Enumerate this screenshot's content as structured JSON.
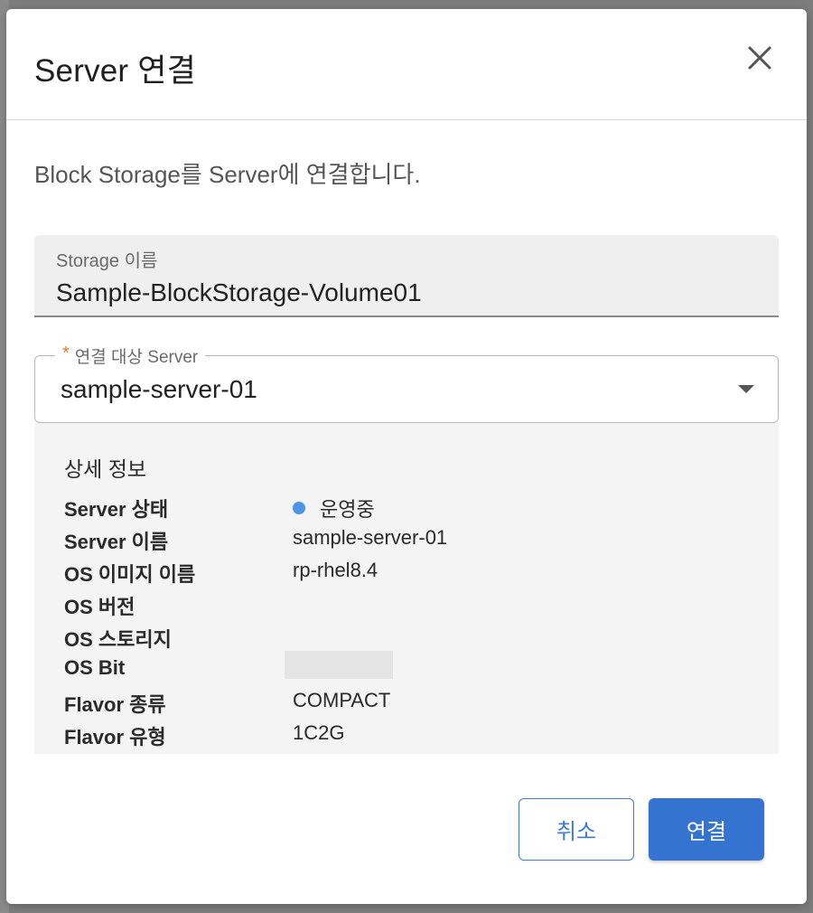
{
  "dialog": {
    "title": "Server 연결",
    "description": "Block Storage를 Server에 연결합니다."
  },
  "storage_field": {
    "label": "Storage 이름",
    "value": "Sample-BlockStorage-Volume01"
  },
  "server_select": {
    "required_mark": "*",
    "label": "연결 대상 Server",
    "selected": "sample-server-01"
  },
  "details": {
    "title": "상세 정보",
    "rows": [
      {
        "key": "Server 상태",
        "value": "운영중",
        "status_color": "#4d93e6"
      },
      {
        "key": "Server 이름",
        "value": "sample-server-01"
      },
      {
        "key": "OS 이미지 이름",
        "value": "rp-rhel8.4"
      },
      {
        "key": "OS 버전",
        "value": ""
      },
      {
        "key": "OS 스토리지",
        "value": ""
      },
      {
        "key": "OS Bit",
        "value": ""
      },
      {
        "key": "Flavor 종류",
        "value": "COMPACT"
      },
      {
        "key": "Flavor 유형",
        "value": "1C2G"
      }
    ]
  },
  "buttons": {
    "cancel": "취소",
    "confirm": "연결"
  },
  "colors": {
    "accent": "#3474d0",
    "required": "#e07b20",
    "status_running": "#4d93e6"
  }
}
